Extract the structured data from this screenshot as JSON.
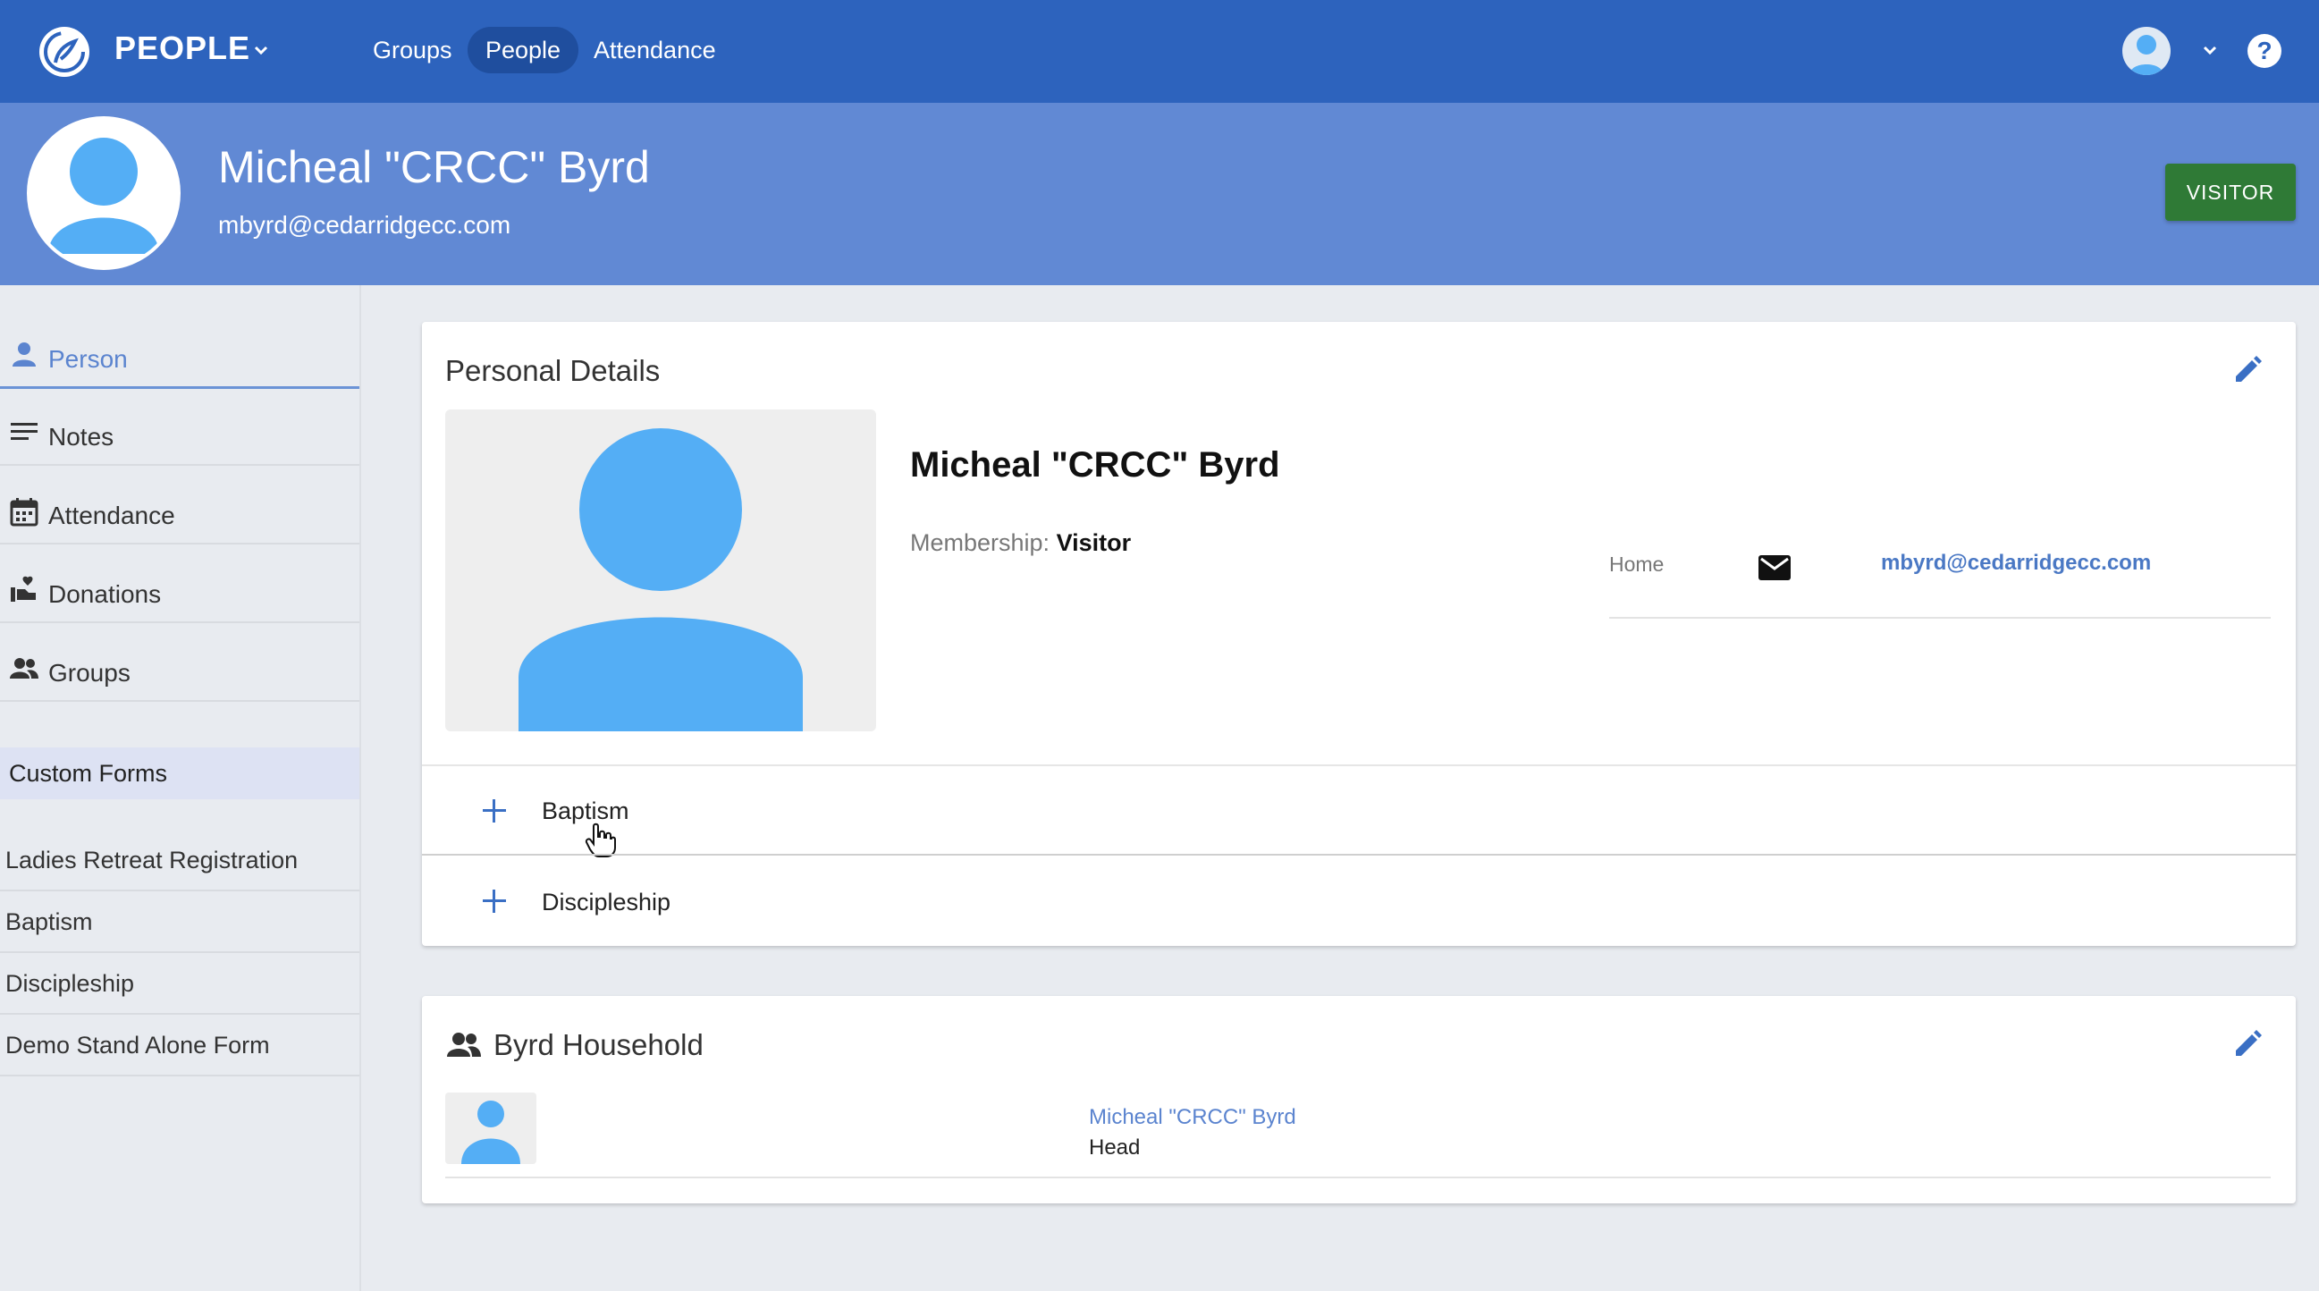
{
  "app": {
    "title": "PEOPLE"
  },
  "nav": {
    "tabs": [
      {
        "label": "Groups"
      },
      {
        "label": "People"
      },
      {
        "label": "Attendance"
      }
    ],
    "help_label": "?"
  },
  "person": {
    "name": "Micheal \"CRCC\" Byrd",
    "email": "mbyrd@cedarridgecc.com",
    "status_button": "VISITOR"
  },
  "sidebar": {
    "items": [
      {
        "label": "Person",
        "icon": "person-icon"
      },
      {
        "label": "Notes",
        "icon": "notes-icon"
      },
      {
        "label": "Attendance",
        "icon": "calendar-icon"
      },
      {
        "label": "Donations",
        "icon": "donations-icon"
      },
      {
        "label": "Groups",
        "icon": "groups-icon"
      }
    ],
    "custom_forms_header": "Custom Forms",
    "forms": [
      {
        "label": "Ladies Retreat Registration"
      },
      {
        "label": "Baptism"
      },
      {
        "label": "Discipleship"
      },
      {
        "label": "Demo Stand Alone Form"
      }
    ]
  },
  "details": {
    "title": "Personal Details",
    "name": "Micheal \"CRCC\" Byrd",
    "membership_label": "Membership:",
    "membership_value": "Visitor",
    "contact": {
      "type": "Home",
      "email": "mbyrd@cedarridgecc.com"
    },
    "forms": [
      {
        "label": "Baptism"
      },
      {
        "label": "Discipleship"
      }
    ]
  },
  "household": {
    "title": "Byrd Household",
    "members": [
      {
        "name": "Micheal \"CRCC\" Byrd",
        "role": "Head"
      }
    ]
  },
  "colors": {
    "primary": "#2d63bd",
    "banner": "#6189d4",
    "visitor": "#2f7a36",
    "avatar": "#54aef5",
    "link": "#4a78c4"
  }
}
